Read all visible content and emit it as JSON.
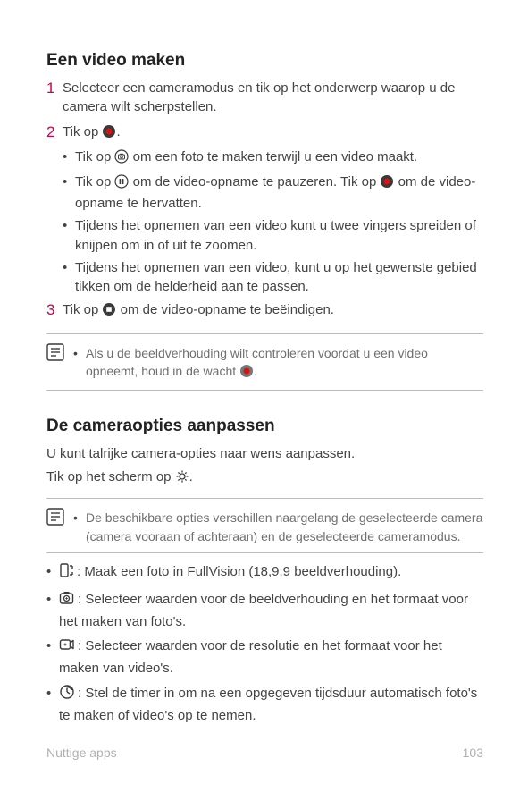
{
  "section1": {
    "title": "Een video maken",
    "step1": "Selecteer een cameramodus en tik op het onderwerp waarop u de camera wilt scherpstellen.",
    "step2_prefix": "Tik op ",
    "step2_suffix": ".",
    "step2_b1_prefix": "Tik op ",
    "step2_b1_suffix": " om een foto te maken terwijl u een video maakt.",
    "step2_b2_prefix": "Tik op ",
    "step2_b2_mid": " om de video-opname te pauzeren. Tik op ",
    "step2_b2_suffix": " om de video-opname te hervatten.",
    "step2_b3": "Tijdens het opnemen van een video kunt u twee vingers spreiden of knijpen om in of uit te zoomen.",
    "step2_b4": "Tijdens het opnemen van een video, kunt u op het gewenste gebied tikken om de helderheid aan te passen.",
    "step3_prefix": "Tik op ",
    "step3_suffix": " om de video-opname te beëindigen.",
    "note_prefix": "Als u de beeldverhouding wilt controleren voordat u een video opneemt, houd in de wacht ",
    "note_suffix": "."
  },
  "section2": {
    "title": "De cameraopties aanpassen",
    "lead1": "U kunt talrijke camera-opties naar wens aanpassen.",
    "lead2_prefix": "Tik op het scherm op ",
    "lead2_suffix": ".",
    "note": "De beschikbare opties verschillen naargelang de geselecteerde camera (camera vooraan of achteraan) en de geselecteerde cameramodus.",
    "opt1": ": Maak een foto in FullVision (18,9:9 beeldverhouding).",
    "opt2": ": Selecteer waarden voor de beeldverhouding en het formaat voor het maken van foto's.",
    "opt3": ": Selecteer waarden voor de resolutie en het formaat voor het maken van video's.",
    "opt4": ": Stel de timer in om na een opgegeven tijdsduur automatisch foto's te maken of video's op te nemen."
  },
  "footer": {
    "left": "Nuttige apps",
    "right": "103"
  }
}
